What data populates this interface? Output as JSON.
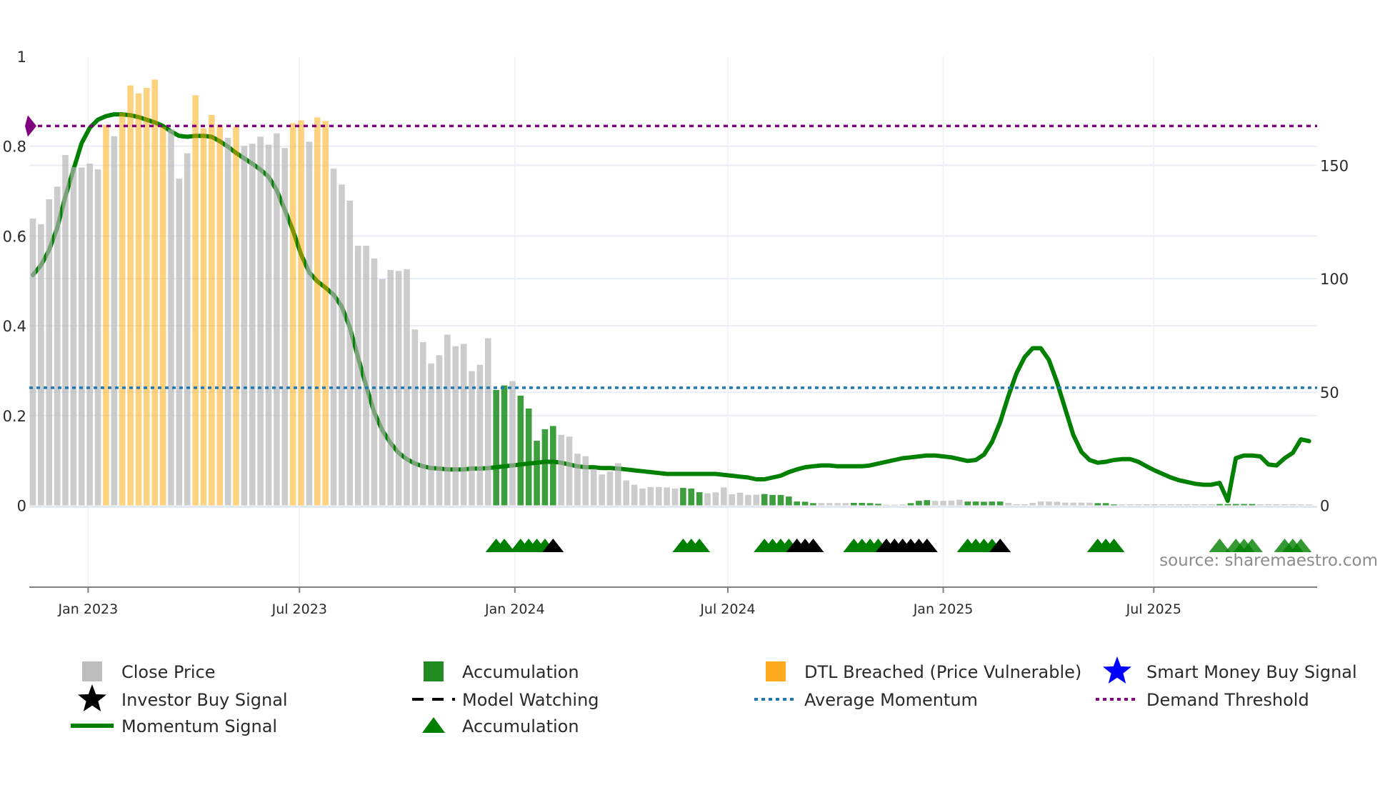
{
  "chart_data": {
    "type": "bar",
    "title": "",
    "left_axis": {
      "ylim": [
        0,
        1
      ],
      "ticks": [
        "0",
        "0.2",
        "0.4",
        "0.6",
        "0.8",
        "1"
      ],
      "tick_values": [
        0,
        0.2,
        0.4,
        0.6,
        0.8,
        1
      ]
    },
    "right_axis": {
      "ylim": [
        0,
        198
      ],
      "ticks": [
        "0",
        "50",
        "100",
        "150"
      ],
      "tick_values": [
        0,
        50,
        100,
        150
      ]
    },
    "x_ticks": [
      {
        "label": "Jan 2023",
        "week": 7.8
      },
      {
        "label": "Jul 2023",
        "week": 33.8
      },
      {
        "label": "Jan 2024",
        "week": 60.3
      },
      {
        "label": "Jul 2024",
        "week": 86.5
      },
      {
        "label": "Jan 2025",
        "week": 113
      },
      {
        "label": "Jul 2025",
        "week": 138.9
      }
    ],
    "close_price": [
      126.5,
      124,
      135,
      140.6,
      154.5,
      149.2,
      149,
      150.7,
      148.2,
      167.9,
      162.8,
      173.2,
      185.2,
      181.7,
      184.1,
      187.8,
      166.9,
      165.8,
      144.1,
      155.3,
      180.9,
      166.3,
      172.2,
      167.9,
      162.1,
      167,
      158.5,
      159.5,
      162.6,
      159.1,
      164.1,
      157.6,
      168.6,
      169.8,
      160.4,
      171.1,
      169.5,
      148.5,
      141.5,
      134.4,
      114.5,
      114.5,
      108.9,
      99.8,
      103.8,
      103.4,
      104.2,
      77.6,
      72,
      62.6,
      66.2,
      75.3,
      70.2,
      71.2,
      59.2,
      62,
      73.7,
      50.9,
      52.9,
      54.8,
      48.4,
      42.7,
      28.5,
      33.6,
      35,
      31.1,
      30.3,
      22.8,
      21.7,
      16,
      13.6,
      14.9,
      18.6,
      11,
      9.1,
      7.4,
      8.1,
      8.1,
      7.9,
      7.4,
      7.7,
      7.4,
      5.8,
      5.3,
      5.7,
      7.9,
      4.9,
      5.6,
      4.6,
      4.7,
      5,
      4.6,
      4.6,
      3.9,
      1.7,
      1.6,
      1,
      1,
      1,
      1,
      1,
      1.1,
      1.1,
      1,
      0.7,
      0.3,
      0.3,
      0.4,
      1,
      2,
      2.3,
      2,
      2,
      2.1,
      2.5,
      1.7,
      1.7,
      1.6,
      1.7,
      1.7,
      1.1,
      0.5,
      0.5,
      1.1,
      1.7,
      1.7,
      1.6,
      1.2,
      1.2,
      1.2,
      1.2,
      1,
      1,
      0.4,
      0.4,
      0.5,
      0.5,
      0.5,
      0.5,
      0.5,
      0.5,
      0.5,
      0.5,
      0.5,
      0.5,
      0.5,
      0.6,
      0.6,
      0.6,
      0.6,
      0.6,
      0.5,
      0.5,
      0.5,
      0.5,
      0.5,
      0.4,
      0.4
    ],
    "dtl_breached_weeks": [
      10,
      12,
      13,
      14,
      15,
      16,
      17,
      21,
      22,
      23,
      24,
      26,
      33,
      34,
      36,
      37
    ],
    "accumulation_weeks": [
      58,
      59,
      61,
      62,
      63,
      64,
      65,
      81,
      82,
      83,
      91,
      92,
      93,
      94,
      95,
      96,
      97,
      102,
      103,
      104,
      105,
      109,
      110,
      111,
      116,
      117,
      118,
      119,
      120,
      132,
      133,
      134,
      147,
      148,
      149,
      150,
      151
    ],
    "momentum_signal": [
      0.513,
      0.535,
      0.569,
      0.618,
      0.688,
      0.748,
      0.807,
      0.841,
      0.859,
      0.867,
      0.871,
      0.871,
      0.869,
      0.865,
      0.859,
      0.853,
      0.845,
      0.833,
      0.823,
      0.821,
      0.823,
      0.823,
      0.821,
      0.811,
      0.799,
      0.785,
      0.773,
      0.761,
      0.748,
      0.732,
      0.702,
      0.658,
      0.612,
      0.559,
      0.519,
      0.499,
      0.485,
      0.469,
      0.443,
      0.396,
      0.33,
      0.266,
      0.207,
      0.167,
      0.139,
      0.117,
      0.103,
      0.093,
      0.087,
      0.083,
      0.082,
      0.08,
      0.08,
      0.08,
      0.082,
      0.082,
      0.083,
      0.085,
      0.087,
      0.089,
      0.091,
      0.093,
      0.095,
      0.097,
      0.097,
      0.095,
      0.091,
      0.087,
      0.085,
      0.085,
      0.083,
      0.083,
      0.082,
      0.08,
      0.078,
      0.076,
      0.074,
      0.072,
      0.07,
      0.07,
      0.07,
      0.07,
      0.07,
      0.07,
      0.07,
      0.068,
      0.066,
      0.064,
      0.062,
      0.058,
      0.058,
      0.062,
      0.066,
      0.074,
      0.08,
      0.085,
      0.087,
      0.089,
      0.089,
      0.087,
      0.087,
      0.087,
      0.087,
      0.089,
      0.093,
      0.097,
      0.101,
      0.105,
      0.107,
      0.109,
      0.111,
      0.111,
      0.109,
      0.107,
      0.103,
      0.099,
      0.101,
      0.113,
      0.141,
      0.185,
      0.243,
      0.294,
      0.33,
      0.35,
      0.35,
      0.324,
      0.274,
      0.215,
      0.157,
      0.119,
      0.101,
      0.095,
      0.097,
      0.101,
      0.103,
      0.103,
      0.097,
      0.087,
      0.078,
      0.07,
      0.062,
      0.056,
      0.052,
      0.048,
      0.046,
      0.046,
      0.05,
      0.01,
      0.105,
      0.111,
      0.111,
      0.109,
      0.091,
      0.089,
      0.105,
      0.117,
      0.147,
      0.143
    ],
    "average_momentum": 0.262,
    "demand_threshold": 0.845,
    "accumulation_signal_weeks": [
      58,
      59,
      61,
      62,
      63,
      64,
      81,
      82,
      83,
      91,
      92,
      93,
      94,
      102,
      103,
      104,
      105,
      116,
      117,
      118,
      119,
      132,
      133,
      134
    ],
    "accumulation_signal_weeks_faded": [
      147,
      149,
      150,
      151,
      155,
      156,
      157
    ],
    "model_watching_weeks": [
      65,
      95,
      96,
      97,
      106,
      107,
      108,
      109,
      110,
      111,
      120
    ],
    "legend": [
      {
        "label": "Close Price",
        "marker": "square",
        "color": "#bdbdbd"
      },
      {
        "label": "Accumulation",
        "marker": "square",
        "color": "#228b22"
      },
      {
        "label": "DTL Breached (Price Vulnerable)",
        "marker": "square",
        "color": "#ffa91f"
      },
      {
        "label": "Smart Money Buy Signal",
        "marker": "star",
        "color": "#0000ff"
      },
      {
        "label": "Investor Buy Signal",
        "marker": "star",
        "color": "#000000"
      },
      {
        "label": "Model Watching",
        "marker": "dash",
        "color": "#000000"
      },
      {
        "label": "Average Momentum",
        "marker": "dot",
        "color": "#1f77b4"
      },
      {
        "label": "Demand Threshold",
        "marker": "dot",
        "color": "#800080"
      },
      {
        "label": "Momentum Signal",
        "marker": "line",
        "color": "#008000"
      },
      {
        "label": "Accumulation",
        "marker": "triangle",
        "color": "#008000"
      }
    ],
    "legend_placement": "bottom",
    "grid": true
  },
  "source": "source: sharemaestro.com",
  "colors": {
    "gray": "#bebebe",
    "orange": "#ffa500",
    "green": "#008000",
    "blue": "#1f77b4",
    "purple": "#800080"
  }
}
